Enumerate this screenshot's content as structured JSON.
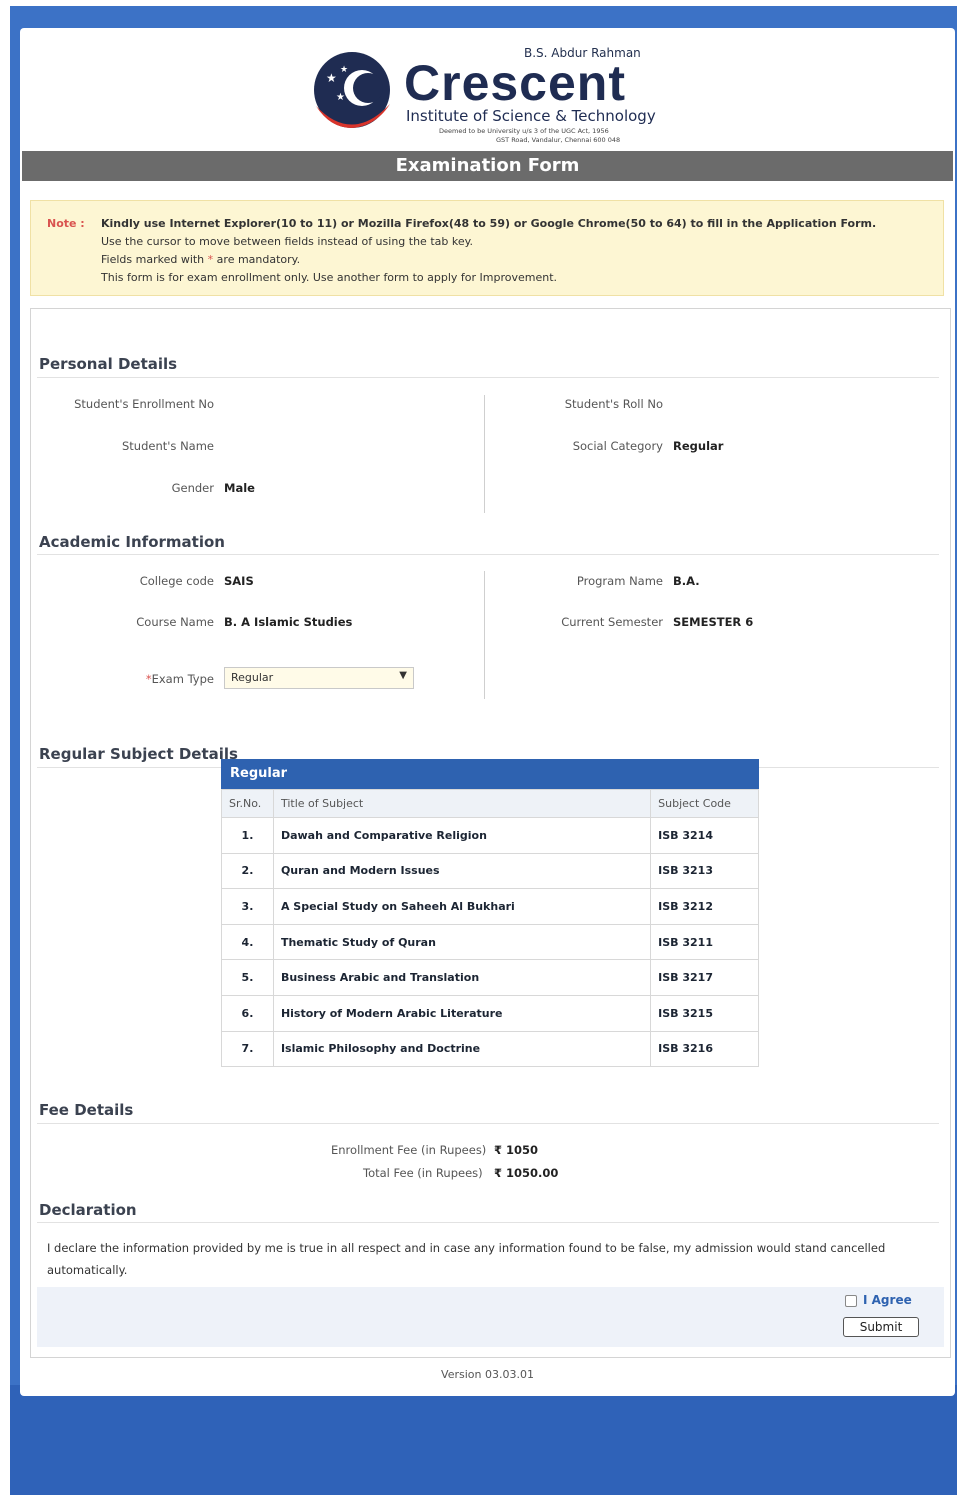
{
  "header": {
    "brand_top": "B.S. Abdur Rahman",
    "brand_name": "Crescent",
    "brand_sub": "Institute of Science & Technology",
    "brand_small1": "Deemed to be University u/s 3 of the UGC Act, 1956",
    "brand_small2": "GST Road, Vandalur, Chennai 600 048",
    "form_title": "Examination Form"
  },
  "note": {
    "label": "Note :",
    "line1": "Kindly use Internet Explorer(10 to 11) or Mozilla Firefox(48 to 59) or Google Chrome(50 to 64) to fill in the Application Form.",
    "line2": "Use the cursor to move between fields instead of using the tab key.",
    "line3_a": "Fields marked with",
    "line3_star": "*",
    "line3_b": "are mandatory.",
    "line4": "This form is for exam enrollment only. Use another form to apply for Improvement."
  },
  "personal": {
    "title": "Personal Details",
    "enrollment_label": "Student's Enrollment No",
    "enrollment_value": "",
    "name_label": "Student's Name",
    "name_value": "",
    "gender_label": "Gender",
    "gender_value": "Male",
    "roll_label": "Student's Roll No",
    "roll_value": "",
    "category_label": "Social Category",
    "category_value": "Regular"
  },
  "academic": {
    "title": "Academic Information",
    "college_label": "College code",
    "college_value": "SAIS",
    "course_label": "Course Name",
    "course_value": "B. A Islamic Studies",
    "exam_type_star": "*",
    "exam_type_label": "Exam Type",
    "exam_type_value": "Regular",
    "program_label": "Program Name",
    "program_value": "B.A.",
    "semester_label": "Current Semester",
    "semester_value": "SEMESTER 6"
  },
  "subjects": {
    "title": "Regular Subject Details",
    "table_title": "Regular",
    "headers": [
      "Sr.No.",
      "Title of Subject",
      "Subject Code"
    ],
    "rows": [
      [
        "1.",
        "Dawah and Comparative Religion",
        "ISB 3214"
      ],
      [
        "2.",
        "Quran and Modern Issues",
        "ISB 3213"
      ],
      [
        "3.",
        "A Special Study on Saheeh Al Bukhari",
        "ISB 3212"
      ],
      [
        "4.",
        "Thematic Study of Quran",
        "ISB 3211"
      ],
      [
        "5.",
        "Business Arabic and Translation",
        "ISB 3217"
      ],
      [
        "6.",
        "History of Modern Arabic Literature",
        "ISB 3215"
      ],
      [
        "7.",
        "Islamic Philosophy and Doctrine",
        "ISB 3216"
      ]
    ]
  },
  "fee": {
    "title": "Fee Details",
    "enrollment_label": "Enrollment Fee (in Rupees)",
    "enrollment_value": "₹ 1050",
    "total_label": "Total Fee (in Rupees)",
    "total_value": "₹ 1050.00"
  },
  "declaration": {
    "title": "Declaration",
    "text": "I declare the information provided by me is true in all respect and in case any information found to be false, my admission would stand cancelled automatically.",
    "agree_label": "I Agree",
    "submit_label": "Submit"
  },
  "footer": {
    "version": "Version 03.03.01"
  },
  "colors": {
    "accent_blue": "#2e62b0",
    "background_blue": "#3c72c6",
    "title_bar": "#6b6b6b",
    "required_red": "#d9534f",
    "note_bg": "#fdf6d3"
  }
}
